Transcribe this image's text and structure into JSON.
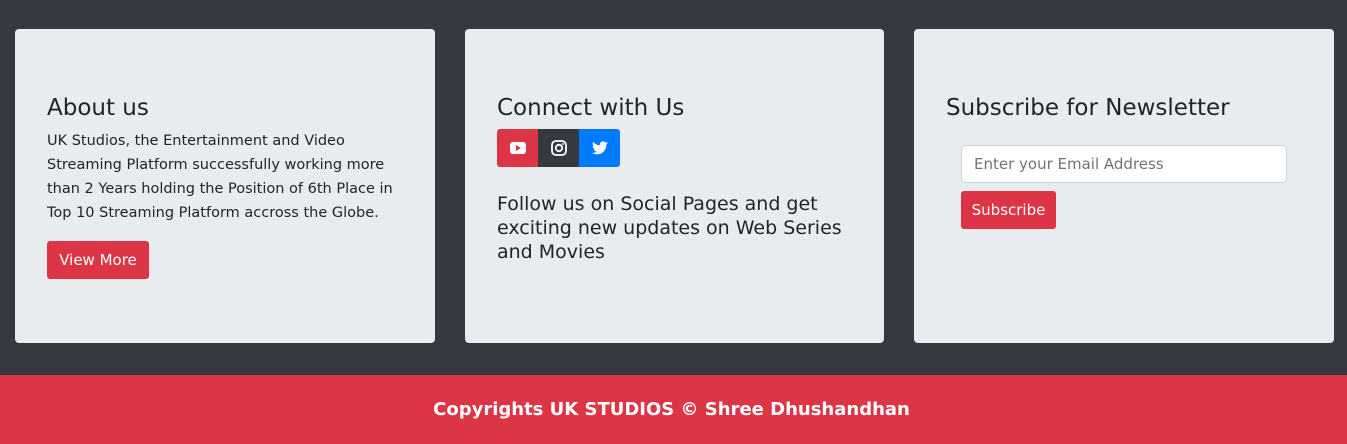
{
  "about": {
    "title": "About us",
    "text": "UK Studios, the Entertainment and Video Streaming Platform successfully working more than 2 Years holding the Position of 6th Place in Top 10 Streaming Platform accross the Globe.",
    "button_label": "View More"
  },
  "connect": {
    "title": "Connect with Us",
    "social_icons": [
      "youtube-icon",
      "instagram-icon",
      "twitter-icon"
    ],
    "follow_text": "Follow us on Social Pages and get exciting new updates on Web Series and Movies"
  },
  "subscribe": {
    "title": "Subscribe for Newsletter",
    "email_placeholder": "Enter your Email Address",
    "email_value": "",
    "button_label": "Subscribe"
  },
  "footer": {
    "text": "Copyrights UK STUDIOS © Shree Dhushandhan"
  },
  "colors": {
    "background": "#343a40",
    "card": "#e9ecef",
    "accent_red": "#dc3545",
    "dark": "#343a40",
    "twitter_blue": "#007bff"
  }
}
